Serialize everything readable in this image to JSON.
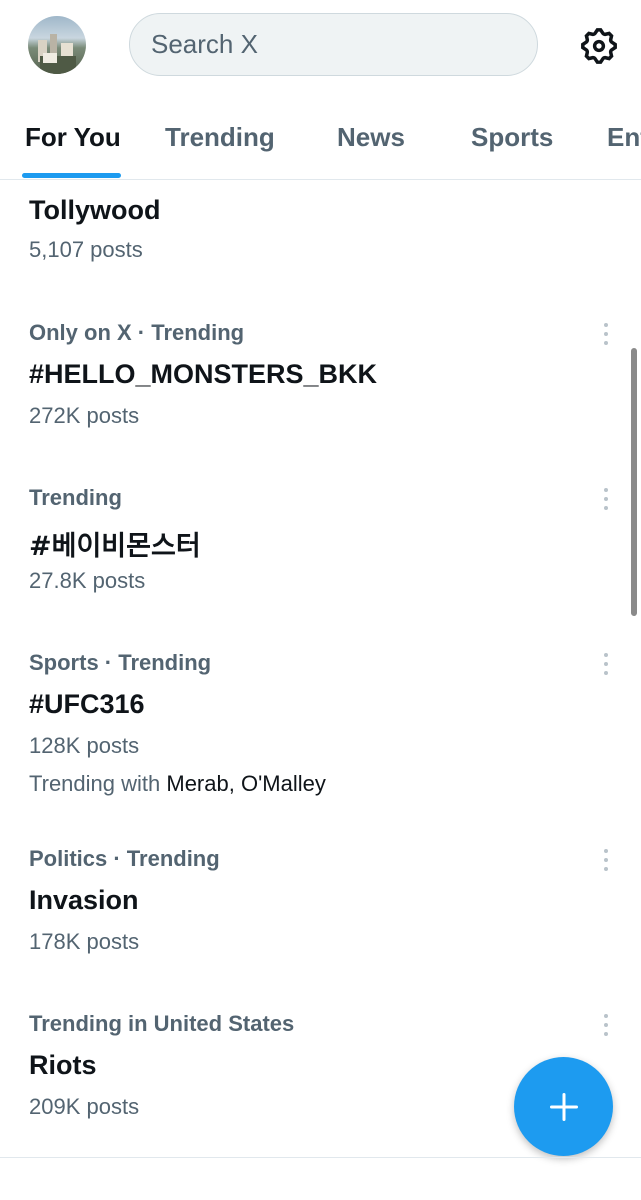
{
  "header": {
    "search_placeholder": "Search X"
  },
  "tabs": [
    {
      "label": "For You",
      "active": true
    },
    {
      "label": "Trending",
      "active": false
    },
    {
      "label": "News",
      "active": false
    },
    {
      "label": "Sports",
      "active": false
    },
    {
      "label": "Ent",
      "active": false
    }
  ],
  "trends": [
    {
      "meta": "",
      "title": "Tollywood",
      "count": "5,107 posts"
    },
    {
      "meta": "Only on X · Trending",
      "title": "#HELLO_MONSTERS_BKK",
      "count": "272K posts"
    },
    {
      "meta": "Trending",
      "title": "#베이비몬스터",
      "count": "27.8K posts"
    },
    {
      "meta": "Sports · Trending",
      "title": "#UFC316",
      "count": "128K posts",
      "with_label": "Trending with ",
      "with_names": "Merab, O'Malley"
    },
    {
      "meta": "Politics · Trending",
      "title": "Invasion",
      "count": "178K posts"
    },
    {
      "meta": "Trending in United States",
      "title": "Riots",
      "count": "209K posts"
    }
  ],
  "colors": {
    "accent": "#1d9bf0",
    "text_primary": "#0f1419",
    "text_secondary": "#536471",
    "search_bg": "#eff3f4"
  },
  "icons": {
    "settings": "gear-icon",
    "more": "more-vertical-icon",
    "compose": "plus-icon"
  }
}
